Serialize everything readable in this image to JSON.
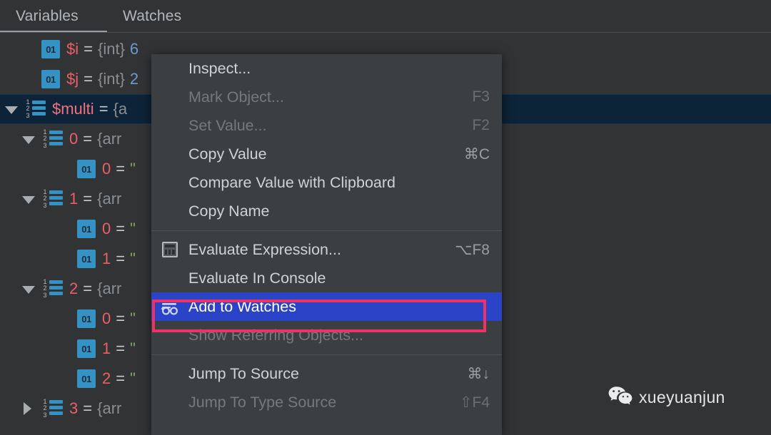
{
  "window": {
    "background": "#313335",
    "panel_background": "#3c3f41"
  },
  "tabs": [
    {
      "label": "Variables",
      "selected": true
    },
    {
      "label": "Watches",
      "selected": false
    }
  ],
  "variables_tree": {
    "rows": [
      {
        "indent": 1,
        "twisty": "none",
        "icon": "primitive-01-icon",
        "name": "$i",
        "eq": "=",
        "type": "{int}",
        "value": "6",
        "value_kind": "number",
        "selected": false
      },
      {
        "indent": 1,
        "twisty": "none",
        "icon": "primitive-01-icon",
        "name": "$j",
        "eq": "=",
        "type": "{int}",
        "value": "2",
        "value_kind": "number",
        "selected": false
      },
      {
        "indent": 0,
        "twisty": "down",
        "icon": "array-123-icon",
        "name": "$multi",
        "eq": "=",
        "type": "{a",
        "value": "",
        "value_kind": "type",
        "selected": true
      },
      {
        "indent": 1,
        "twisty": "down",
        "icon": "array-123-icon",
        "name": "0",
        "eq": "=",
        "type": "{arr",
        "value": "",
        "value_kind": "type",
        "selected": false
      },
      {
        "indent": 2,
        "twisty": "none",
        "icon": "primitive-01-icon",
        "name": "0",
        "eq": "=",
        "type": "",
        "value": "\"",
        "value_kind": "string",
        "selected": false
      },
      {
        "indent": 1,
        "twisty": "down",
        "icon": "array-123-icon",
        "name": "1",
        "eq": "=",
        "type": "{arr",
        "value": "",
        "value_kind": "type",
        "selected": false
      },
      {
        "indent": 2,
        "twisty": "none",
        "icon": "primitive-01-icon",
        "name": "0",
        "eq": "=",
        "type": "",
        "value": "\"",
        "value_kind": "string",
        "selected": false
      },
      {
        "indent": 2,
        "twisty": "none",
        "icon": "primitive-01-icon",
        "name": "1",
        "eq": "=",
        "type": "",
        "value": "\"",
        "value_kind": "string",
        "selected": false
      },
      {
        "indent": 1,
        "twisty": "down",
        "icon": "array-123-icon",
        "name": "2",
        "eq": "=",
        "type": "{arr",
        "value": "",
        "value_kind": "type",
        "selected": false
      },
      {
        "indent": 2,
        "twisty": "none",
        "icon": "primitive-01-icon",
        "name": "0",
        "eq": "=",
        "type": "",
        "value": "\"",
        "value_kind": "string",
        "selected": false
      },
      {
        "indent": 2,
        "twisty": "none",
        "icon": "primitive-01-icon",
        "name": "1",
        "eq": "=",
        "type": "",
        "value": "\"",
        "value_kind": "string",
        "selected": false
      },
      {
        "indent": 2,
        "twisty": "none",
        "icon": "primitive-01-icon",
        "name": "2",
        "eq": "=",
        "type": "",
        "value": "\"",
        "value_kind": "string",
        "selected": false
      },
      {
        "indent": 1,
        "twisty": "right",
        "icon": "array-123-icon",
        "name": "3",
        "eq": "=",
        "type": "{arr",
        "value": "",
        "value_kind": "type",
        "selected": false
      }
    ],
    "colors": {
      "name": "#eb5f6a",
      "type": "#8b8e91",
      "number": "#6b9bd2",
      "string": "#7ba85a",
      "selected_row": "#0d2338"
    }
  },
  "context_menu": {
    "groups": [
      {
        "items": [
          {
            "label": "Inspect...",
            "accel": "",
            "icon": "",
            "disabled": false,
            "highlighted": false
          },
          {
            "label": "Mark Object...",
            "accel": "F3",
            "icon": "",
            "disabled": true,
            "highlighted": false
          },
          {
            "label": "Set Value...",
            "accel": "F2",
            "icon": "",
            "disabled": true,
            "highlighted": false
          },
          {
            "label": "Copy Value",
            "accel": "⌘C",
            "icon": "",
            "disabled": false,
            "highlighted": false
          },
          {
            "label": "Compare Value with Clipboard",
            "accel": "",
            "icon": "",
            "disabled": false,
            "highlighted": false
          },
          {
            "label": "Copy Name",
            "accel": "",
            "icon": "",
            "disabled": false,
            "highlighted": false
          }
        ]
      },
      {
        "items": [
          {
            "label": "Evaluate Expression...",
            "accel": "⌥F8",
            "icon": "calculator-icon",
            "disabled": false,
            "highlighted": false
          },
          {
            "label": "Evaluate In Console",
            "accel": "",
            "icon": "",
            "disabled": false,
            "highlighted": false
          },
          {
            "label": "Add to Watches",
            "accel": "",
            "icon": "glasses-icon",
            "disabled": false,
            "highlighted": true
          },
          {
            "label": "Show Referring Objects...",
            "accel": "",
            "icon": "",
            "disabled": true,
            "highlighted": false
          }
        ]
      },
      {
        "items": [
          {
            "label": "Jump To Source",
            "accel": "⌘↓",
            "icon": "",
            "disabled": false,
            "highlighted": false
          },
          {
            "label": "Jump To Type Source",
            "accel": "⇧F4",
            "icon": "",
            "disabled": true,
            "highlighted": false
          }
        ]
      }
    ],
    "highlight_color": "#2b44c7",
    "background": "#3c3f41"
  },
  "annotation": {
    "target": "Add to Watches",
    "color": "#ee3266",
    "shape": "rectangle-outline"
  },
  "watermark": {
    "text": "xueyuanjun",
    "icon": "wechat-icon"
  }
}
